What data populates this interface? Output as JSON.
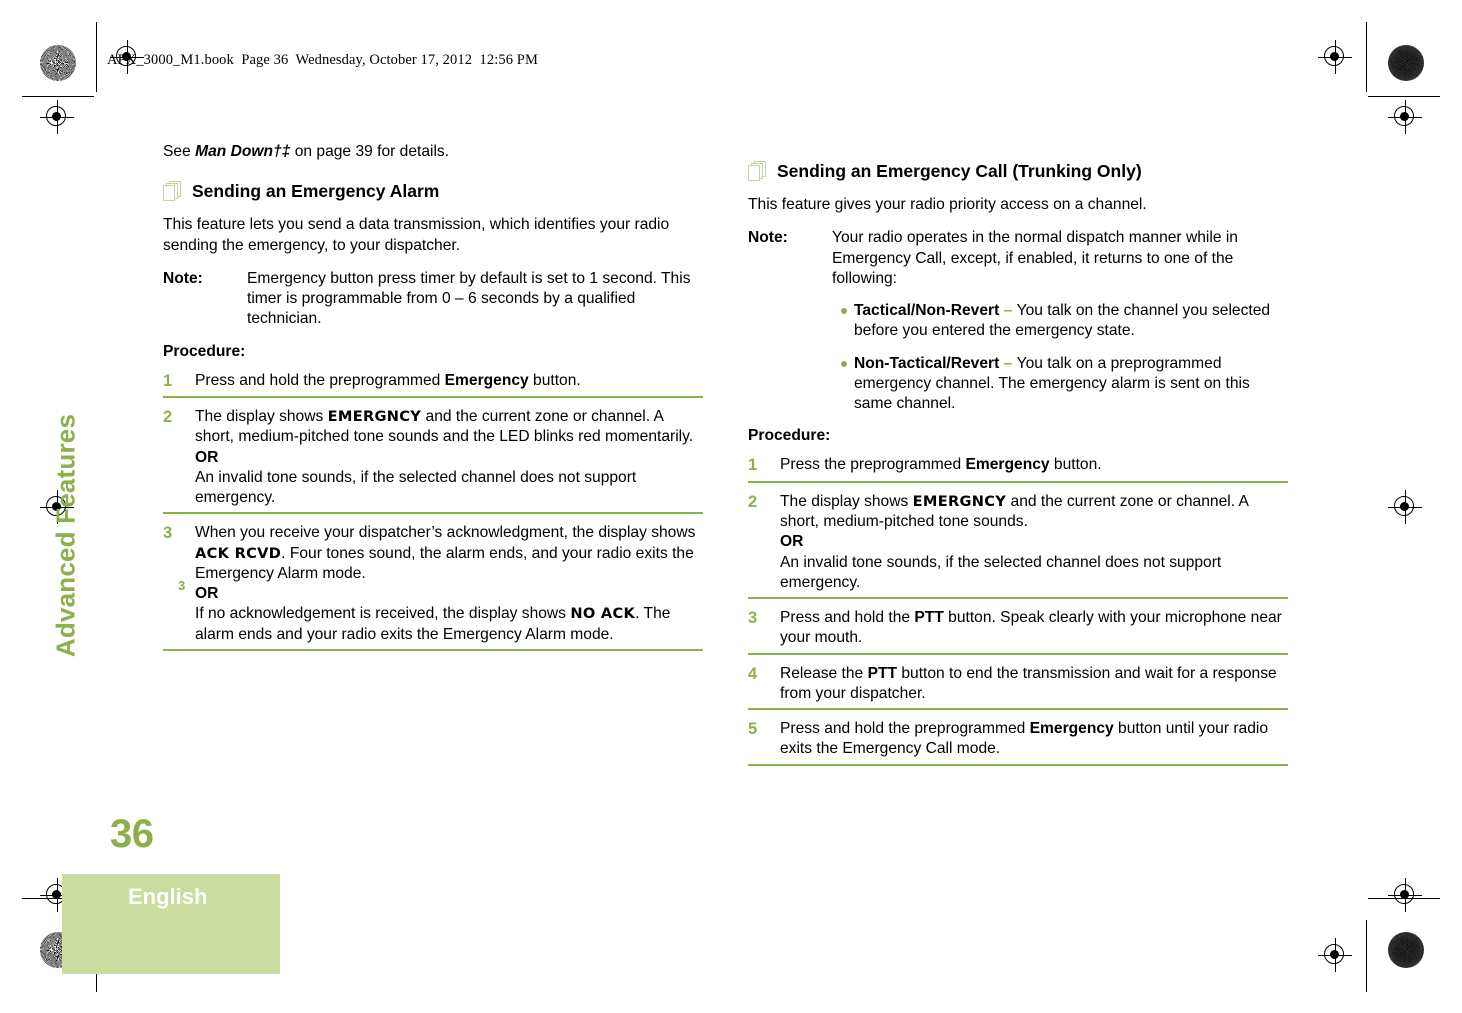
{
  "running_header": "APX_3000_M1.book  Page 36  Wednesday, October 17, 2012  12:56 PM",
  "margin": {
    "chapter_title": "Advanced Features",
    "chapter_number": "3",
    "page_number": "36",
    "language": "English"
  },
  "left_column": {
    "intro_see": {
      "prefix": "See ",
      "term": "Man Down†‡",
      "suffix": " on page 39 for details."
    },
    "section": {
      "icon": "stacked-pages-icon",
      "title": "Sending an Emergency Alarm"
    },
    "lead": "This feature lets you send a data transmission, which identifies your radio sending the emergency, to your dispatcher.",
    "note": {
      "label": "Note:",
      "body": "Emergency button press timer by default is set to 1 second. This timer is programmable from 0 – 6 seconds by a qualified technician."
    },
    "procedure_label": "Procedure:",
    "steps": [
      {
        "num": "1",
        "parts": [
          {
            "t": "text",
            "v": "Press and hold the preprogrammed "
          },
          {
            "t": "bold",
            "v": "Emergency"
          },
          {
            "t": "text",
            "v": " button."
          }
        ]
      },
      {
        "num": "2",
        "parts": [
          {
            "t": "text",
            "v": "The display shows "
          },
          {
            "t": "lcd",
            "v": "EMERGNCY"
          },
          {
            "t": "text",
            "v": " and the current zone or channel. A short, medium-pitched tone sounds and the LED blinks red momentarily."
          },
          {
            "t": "break"
          },
          {
            "t": "bold",
            "v": "OR"
          },
          {
            "t": "break"
          },
          {
            "t": "text",
            "v": "An invalid tone sounds, if the selected channel does not support emergency."
          }
        ]
      },
      {
        "num": "3",
        "parts": [
          {
            "t": "text",
            "v": "When you receive your dispatcher’s acknowledgment, the display shows "
          },
          {
            "t": "lcd",
            "v": "ACK RCVD"
          },
          {
            "t": "text",
            "v": ". Four tones sound, the alarm ends, and your radio exits the Emergency Alarm mode."
          },
          {
            "t": "break"
          },
          {
            "t": "bold",
            "v": "OR"
          },
          {
            "t": "break"
          },
          {
            "t": "text",
            "v": "If no acknowledgement is received, the display shows "
          },
          {
            "t": "lcd",
            "v": "NO ACK"
          },
          {
            "t": "text",
            "v": ". The alarm ends and your radio exits the Emergency Alarm mode."
          }
        ]
      }
    ]
  },
  "right_column": {
    "section": {
      "icon": "stacked-pages-icon",
      "title": "Sending an Emergency Call (Trunking Only)"
    },
    "lead": "This feature gives your radio priority access on a channel.",
    "note": {
      "label": "Note:",
      "body": "Your radio operates in the normal dispatch manner while in Emergency Call, except, if enabled, it returns to one of the following:",
      "bullets": [
        {
          "term": "Tactical/Non-Revert",
          "dash": "–",
          "text": "You talk on the channel you selected before you entered the emergency state."
        },
        {
          "term": "Non-Tactical/Revert",
          "dash": "–",
          "text": "You talk on a preprogrammed emergency channel. The emergency alarm is sent on this same channel."
        }
      ]
    },
    "procedure_label": "Procedure:",
    "steps": [
      {
        "num": "1",
        "parts": [
          {
            "t": "text",
            "v": "Press the preprogrammed "
          },
          {
            "t": "bold",
            "v": "Emergency"
          },
          {
            "t": "text",
            "v": " button."
          }
        ]
      },
      {
        "num": "2",
        "parts": [
          {
            "t": "text",
            "v": "The display shows "
          },
          {
            "t": "lcd",
            "v": "EMERGNCY"
          },
          {
            "t": "text",
            "v": " and the current zone or channel. A short, medium-pitched tone sounds."
          },
          {
            "t": "break"
          },
          {
            "t": "bold",
            "v": "OR"
          },
          {
            "t": "break"
          },
          {
            "t": "text",
            "v": "An invalid tone sounds, if the selected channel does not support emergency."
          }
        ]
      },
      {
        "num": "3",
        "parts": [
          {
            "t": "text",
            "v": "Press and hold the "
          },
          {
            "t": "bold",
            "v": "PTT"
          },
          {
            "t": "text",
            "v": " button. Speak clearly with your microphone near your mouth."
          }
        ]
      },
      {
        "num": "4",
        "parts": [
          {
            "t": "text",
            "v": "Release the "
          },
          {
            "t": "bold",
            "v": "PTT"
          },
          {
            "t": "text",
            "v": " button to end the transmission and wait for a response from your dispatcher."
          }
        ]
      },
      {
        "num": "5",
        "parts": [
          {
            "t": "text",
            "v": "Press and hold the preprogrammed "
          },
          {
            "t": "bold",
            "v": "Emergency"
          },
          {
            "t": "text",
            "v": " button until your radio exits the Emergency Call mode."
          }
        ]
      }
    ]
  },
  "colors": {
    "accent_green": "#8CB04A",
    "pale_green": "#CBDCA0",
    "icon_green": "#C3D69B"
  }
}
